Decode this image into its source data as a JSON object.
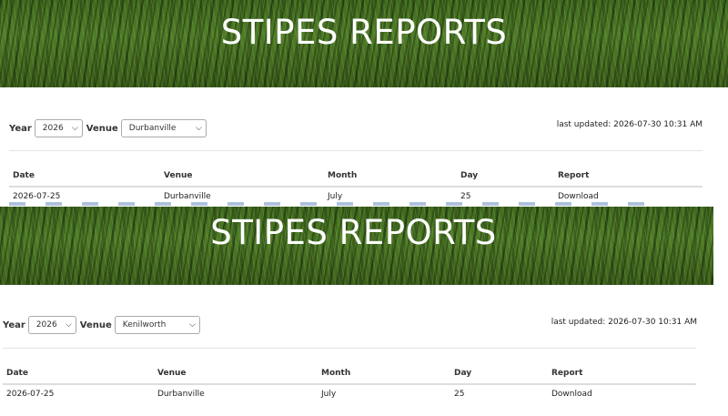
{
  "top": {
    "banner_title": "STIPES REPORTS",
    "filters": {
      "year_label": "Year",
      "year_value": "2026",
      "venue_label": "Venue",
      "venue_value": "Durbanville"
    },
    "last_updated": "last updated: 2026-07-30 10:31 AM",
    "table": {
      "headers": [
        "Date",
        "Venue",
        "Month",
        "Day",
        "Report"
      ],
      "rows": [
        {
          "date": "2026-07-25",
          "venue": "Durbanville",
          "month": "July",
          "day": "25",
          "report": "Download"
        }
      ]
    }
  },
  "bottom": {
    "banner_title": "STIPES REPORTS",
    "filters": {
      "year_label": "Year",
      "year_value": "2026",
      "venue_label": "Venue",
      "venue_value": "Kenilworth"
    },
    "last_updated": "last updated: 2026-07-30 10:31 AM",
    "table": {
      "headers": [
        "Date",
        "Venue",
        "Month",
        "Day",
        "Report"
      ],
      "rows": [
        {
          "date": "2026-07-25",
          "venue": "Durbanville",
          "month": "July",
          "day": "25",
          "report": "Download"
        }
      ]
    }
  },
  "icons": {
    "dropdown": "chevron-down-icon"
  },
  "colors": {
    "link": "#1a4f9c",
    "banner_green": "#4f7d28"
  }
}
